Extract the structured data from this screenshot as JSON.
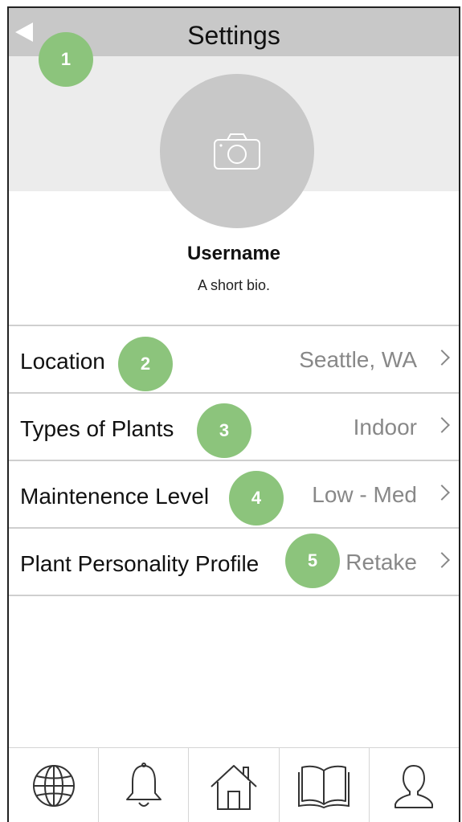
{
  "header": {
    "title": "Settings",
    "back_icon": "back-arrow-icon"
  },
  "profile": {
    "avatar_icon": "camera-icon",
    "username": "Username",
    "bio": "A short bio."
  },
  "settings": [
    {
      "label": "Location",
      "value": "Seattle, WA"
    },
    {
      "label": "Types of Plants",
      "value": "Indoor"
    },
    {
      "label": "Maintenence Level",
      "value": "Low - Med"
    },
    {
      "label": "Plant Personality Profile",
      "value": "Retake"
    }
  ],
  "markers": [
    "1",
    "2",
    "3",
    "4",
    "5"
  ],
  "tabbar": {
    "icons": [
      "globe-icon",
      "bell-icon",
      "home-icon",
      "book-icon",
      "user-icon"
    ]
  },
  "colors": {
    "header_bg": "#c8c8c8",
    "marker_green": "#8cc47c",
    "value_gray": "#888888"
  }
}
